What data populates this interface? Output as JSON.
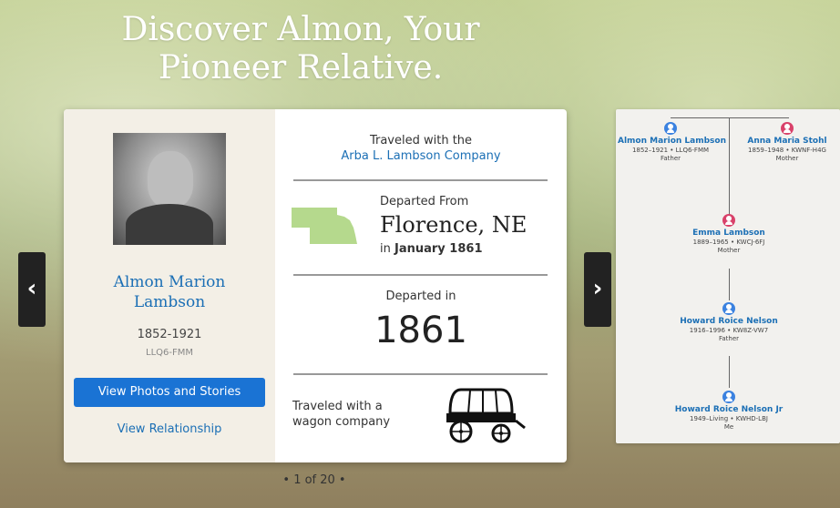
{
  "hero": {
    "title_line1": "Discover Almon, Your",
    "title_line2": "Pioneer Relative."
  },
  "person": {
    "name_line1": "Almon Marion",
    "name_line2": "Lambson",
    "years": "1852-1921",
    "pid": "LLQ6-FMM",
    "view_photos_label": "View Photos and Stories",
    "view_relationship_label": "View Relationship"
  },
  "journey": {
    "traveled_with_label": "Traveled with the",
    "company": "Arba L. Lambson Company",
    "departed_from_label": "Departed From",
    "departed_from_place": "Florence, NE",
    "departed_from_in": "in",
    "departed_from_when": "January 1861",
    "departed_in_label": "Departed in",
    "departed_in_year": "1861",
    "wagon_line1": "Traveled with a",
    "wagon_line2": "wagon company"
  },
  "carousel": {
    "prev_icon": "chevron-left-icon",
    "next_icon": "chevron-right-icon",
    "prev_glyph": "‹",
    "next_glyph": "›",
    "pager": "• 1 of 20 •"
  },
  "tree": {
    "father": {
      "name": "Almon Marion Lambson",
      "info": "1852–1921 • LLQ6-FMM",
      "relation": "Father"
    },
    "mother": {
      "name": "Anna Maria Stohl",
      "info": "1859–1948 • KWNF-H4G",
      "relation": "Mother"
    },
    "gen2": {
      "name": "Emma Lambson",
      "info": "1889–1965 • KWCJ-6FJ",
      "relation": "Mother"
    },
    "gen3": {
      "name": "Howard Roice Nelson",
      "info": "1916–1996 • KW8Z-VW7",
      "relation": "Father"
    },
    "gen4": {
      "name": "Howard Roice Nelson Jr",
      "info": "1949–Living • KWHD-LBJ",
      "relation": "Me"
    }
  },
  "colors": {
    "link": "#1b6fb5",
    "button": "#1a73d4",
    "male": "#3b82e0",
    "female": "#d9416a",
    "state": "#b5d98d"
  }
}
